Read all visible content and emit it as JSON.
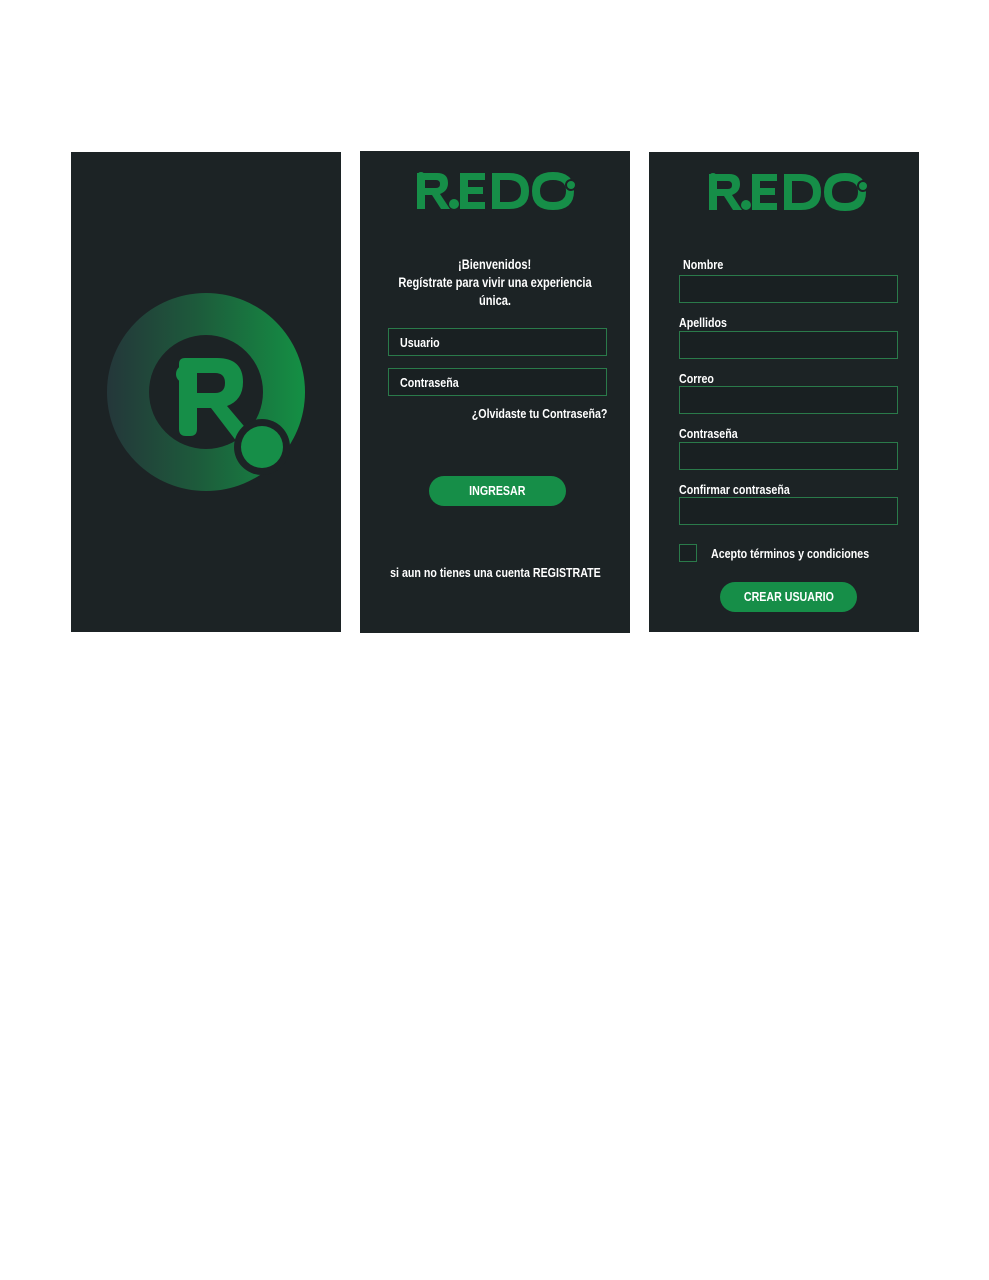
{
  "brand": {
    "name": "REDO",
    "logo_color": "#168e48"
  },
  "splash": {
    "logo_icon": "redo-r-icon"
  },
  "login": {
    "welcome_line1": "¡Bienvenidos!",
    "welcome_line2": "Regístrate para vivir una experiencia  única.",
    "username_placeholder": "Usuario",
    "password_placeholder": "Contraseña",
    "forgot_link": "¿Olvidaste tu Contraseña?",
    "submit_label": "INGRESAR",
    "register_prompt": "si aun no tienes una cuenta REGISTRATE"
  },
  "register": {
    "fields": [
      {
        "label": "Nombre"
      },
      {
        "label": "Apellidos"
      },
      {
        "label": "Correo"
      },
      {
        "label": "Contraseña"
      },
      {
        "label": "Confirmar contraseña"
      }
    ],
    "terms_label": "Acepto términos y condiciones",
    "submit_label": "CREAR USUARIO"
  },
  "colors": {
    "background": "#1c2325",
    "accent": "#168e48",
    "field_border": "#2a7a4a"
  }
}
